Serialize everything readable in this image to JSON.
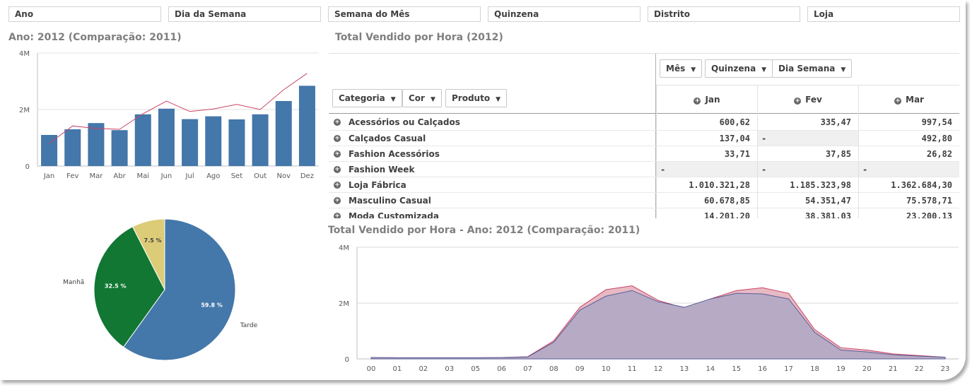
{
  "filters": [
    "Ano",
    "Dia da Semana",
    "Semana do Mês",
    "Quinzena",
    "Distrito",
    "Loja"
  ],
  "bar_title": "Ano: 2012 (Comparação: 2011)",
  "pivot_title": "Total Vendido por Hora (2012)",
  "area_title": "Total Vendido por Hora - Ano: 2012 (Comparação: 2011)",
  "pivot": {
    "col_dims": [
      "Mês",
      "Quinzena",
      "Dia Semana"
    ],
    "row_dims": [
      "Categoria",
      "Cor",
      "Produto"
    ],
    "columns": [
      "Jan",
      "Fev",
      "Mar"
    ],
    "rows": [
      {
        "label": "Acessórios ou Calçados",
        "values": [
          "600,62",
          "335,47",
          "997,54"
        ]
      },
      {
        "label": "Calçados Casual",
        "values": [
          "137,04",
          "-",
          "492,80"
        ]
      },
      {
        "label": "Fashion Acessórios",
        "values": [
          "33,71",
          "37,85",
          "26,82"
        ]
      },
      {
        "label": "Fashion Week",
        "values": [
          "-",
          "-",
          "-"
        ]
      },
      {
        "label": "Loja Fábrica",
        "values": [
          "1.010.321,28",
          "1.185.323,98",
          "1.362.684,30"
        ]
      },
      {
        "label": "Masculino Casual",
        "values": [
          "60.678,85",
          "54.351,47",
          "75.578,71"
        ]
      },
      {
        "label": "Moda Customizada",
        "values": [
          "14.201,20",
          "38.381,03",
          "23.200,13"
        ]
      }
    ]
  },
  "colors": {
    "bar": "#4477aa",
    "line": "#cc4466",
    "pie_tarde": "#4477aa",
    "pie_manha": "#117733",
    "pie_noite": "#ddcc77",
    "area_fill": "#b7aac4",
    "area_compare": "#e7b9c3"
  },
  "chart_data": [
    {
      "type": "bar",
      "categories": [
        "Jan",
        "Fev",
        "Mar",
        "Abr",
        "Mai",
        "Jun",
        "Jul",
        "Ago",
        "Set",
        "Out",
        "Nov",
        "Dez"
      ],
      "series": [
        {
          "values": [
            1.1,
            1.3,
            1.52,
            1.27,
            1.83,
            2.03,
            1.66,
            1.76,
            1.65,
            1.83,
            2.3,
            2.84
          ]
        },
        {
          "values": [
            0.8,
            1.42,
            1.33,
            1.3,
            1.85,
            2.3,
            1.93,
            2.02,
            2.18,
            2.0,
            2.7,
            3.28
          ]
        }
      ],
      "yticks": [
        "0",
        "2M",
        "4M"
      ],
      "ylim": [
        0,
        4
      ]
    },
    {
      "type": "pie",
      "slices": [
        {
          "label": "Tarde",
          "value": 59.8,
          "text": "59.8 %"
        },
        {
          "label": "Manhã",
          "value": 32.5,
          "text": "32.5 %"
        },
        {
          "label": "Noite",
          "value": 7.5,
          "text": "7.5 %"
        }
      ]
    },
    {
      "type": "area",
      "categories": [
        "00",
        "01",
        "02",
        "03",
        "05",
        "06",
        "07",
        "08",
        "09",
        "10",
        "11",
        "12",
        "13",
        "14",
        "15",
        "16",
        "17",
        "18",
        "19",
        "20",
        "21",
        "22",
        "23"
      ],
      "series": [
        {
          "values": [
            0.05,
            0.04,
            0.04,
            0.04,
            0.04,
            0.05,
            0.07,
            0.6,
            1.75,
            2.25,
            2.45,
            2.05,
            1.85,
            2.15,
            2.35,
            2.33,
            2.15,
            0.95,
            0.32,
            0.25,
            0.15,
            0.1,
            0.06
          ]
        },
        {
          "values": [
            0.05,
            0.04,
            0.04,
            0.04,
            0.04,
            0.05,
            0.08,
            0.65,
            1.85,
            2.48,
            2.62,
            2.1,
            1.82,
            2.15,
            2.45,
            2.55,
            2.35,
            1.05,
            0.4,
            0.32,
            0.18,
            0.12,
            0.06
          ]
        }
      ],
      "yticks": [
        "0",
        "2M",
        "4M"
      ],
      "ylim": [
        0,
        4
      ]
    }
  ]
}
